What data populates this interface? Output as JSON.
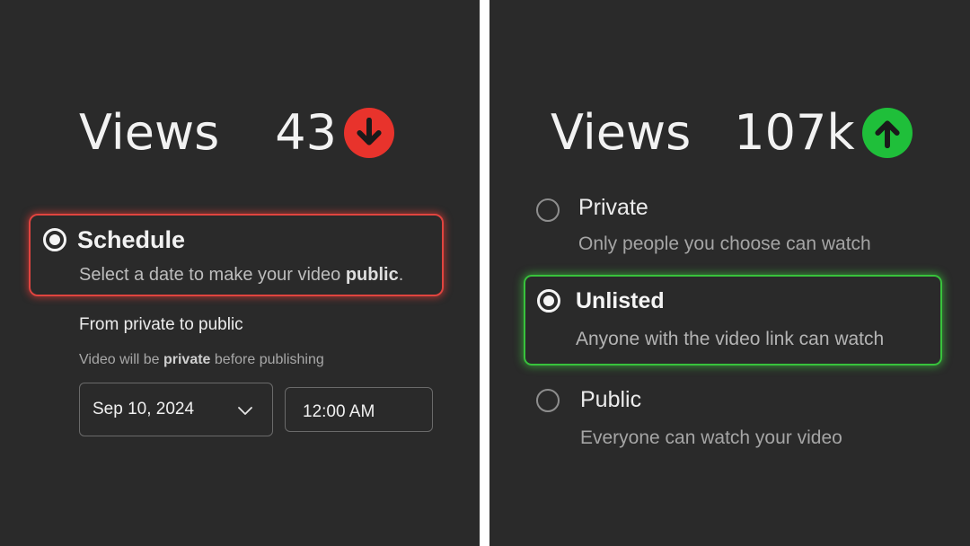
{
  "before": {
    "views_label": "Views",
    "views_count": "43",
    "trend_icon": "arrow-down-icon",
    "trend_color": "#e8332c",
    "schedule": {
      "title": "Schedule",
      "desc_prefix": "Select a date to make your video ",
      "desc_bold": "public",
      "desc_suffix": ".",
      "highlight_color": "#e0443f"
    },
    "from_private_label": "From private to public",
    "note": {
      "prefix": "Video will be ",
      "bold": "private",
      "suffix": " before publishing"
    },
    "date_value": "Sep 10, 2024",
    "time_value": "12:00 AM"
  },
  "after": {
    "views_label": "Views",
    "views_count": "107k",
    "trend_icon": "arrow-up-icon",
    "trend_color": "#1fbf3a",
    "highlight_color": "#38c23c",
    "options": [
      {
        "title": "Private",
        "desc": "Only people you choose can watch",
        "selected": false
      },
      {
        "title": "Unlisted",
        "desc": "Anyone with the video link can watch",
        "selected": true
      },
      {
        "title": "Public",
        "desc": "Everyone can watch your video",
        "selected": false
      }
    ]
  }
}
